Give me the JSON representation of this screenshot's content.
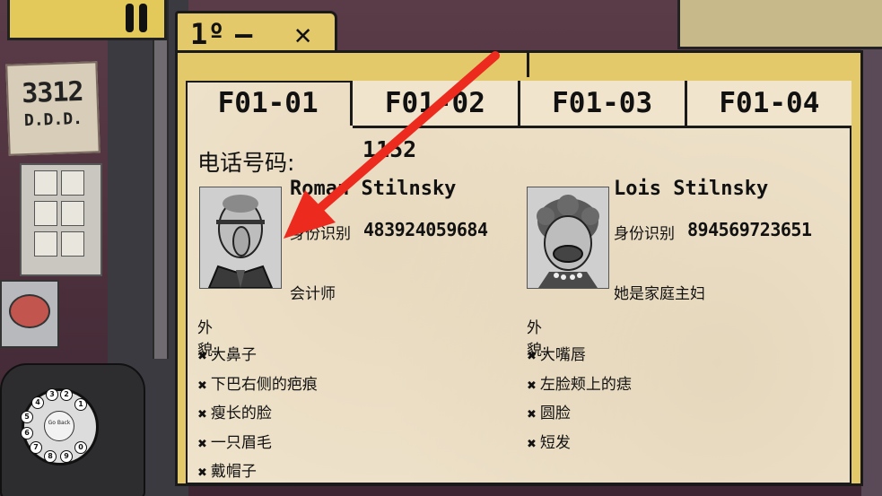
{
  "hud": {
    "note_number": "3312",
    "note_letters": "D.D.D."
  },
  "phone": {
    "dial_center": "Go Back",
    "digits": [
      "1",
      "2",
      "3",
      "4",
      "5",
      "6",
      "7",
      "8",
      "9",
      "0"
    ]
  },
  "window": {
    "title": "1º",
    "minimize": "—",
    "close": "✕"
  },
  "tabs": [
    {
      "label": "F01-01",
      "active": true
    },
    {
      "label": "F01-02",
      "active": false
    },
    {
      "label": "F01-03",
      "active": false
    },
    {
      "label": "F01-04",
      "active": false
    }
  ],
  "record": {
    "phone_label": "电话号码:",
    "phone_number": "1152",
    "appearance_label": "外貌:",
    "id_label": "身份识别",
    "people": [
      {
        "name": "Roman Stilnsky",
        "id_number": "483924059684",
        "occupation": "会计师",
        "traits": [
          "大鼻子",
          "下巴右侧的疤痕",
          "瘦长的脸",
          "一只眉毛",
          "戴帽子"
        ]
      },
      {
        "name": "Lois Stilnsky",
        "id_number": "894569723651",
        "occupation": "她是家庭主妇",
        "traits": [
          "大嘴唇",
          "左脸颊上的痣",
          "圆脸",
          "短发"
        ]
      }
    ]
  },
  "colors": {
    "window_frame": "#e4c96a",
    "paper": "#efe3cc",
    "arrow": "#ec2a1e"
  }
}
